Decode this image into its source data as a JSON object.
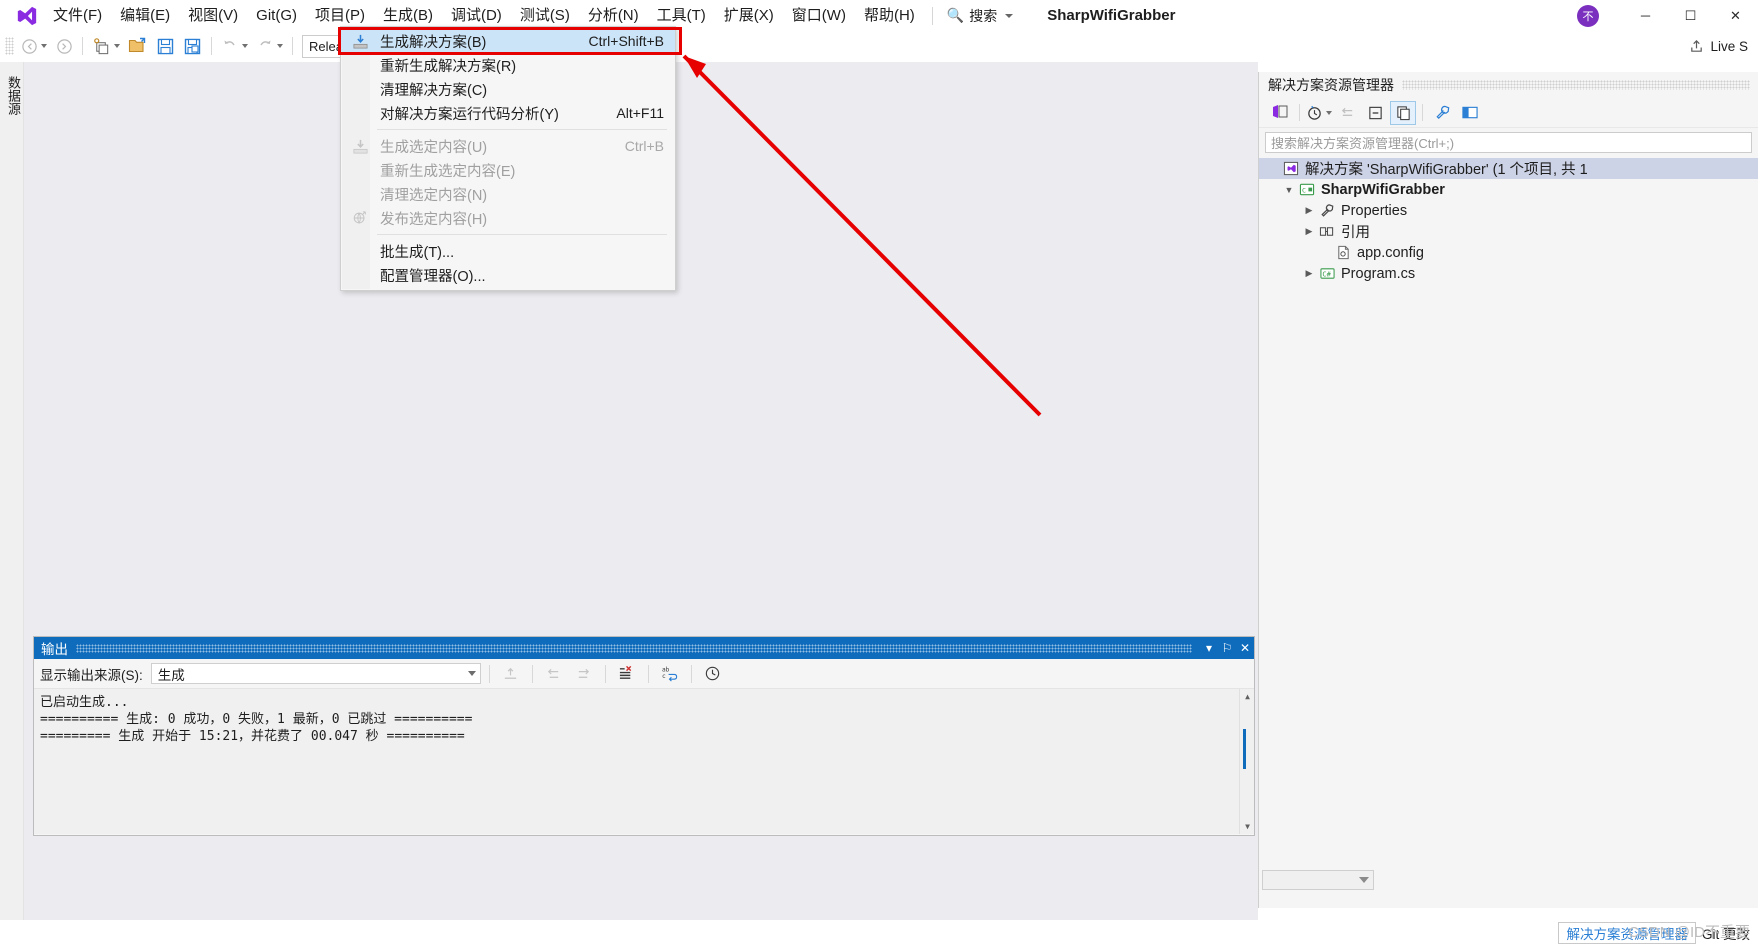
{
  "window": {
    "project_title": "SharpWifiGrabber",
    "account_initial": "不",
    "minimize": "─",
    "maximize": "☐",
    "close": "✕"
  },
  "menubar": {
    "items": [
      {
        "label": "文件(F)"
      },
      {
        "label": "编辑(E)"
      },
      {
        "label": "视图(V)"
      },
      {
        "label": "Git(G)"
      },
      {
        "label": "项目(P)"
      },
      {
        "label": "生成(B)"
      },
      {
        "label": "调试(D)"
      },
      {
        "label": "测试(S)"
      },
      {
        "label": "分析(N)"
      },
      {
        "label": "工具(T)"
      },
      {
        "label": "扩展(X)"
      },
      {
        "label": "窗口(W)"
      },
      {
        "label": "帮助(H)"
      }
    ],
    "search_label": "搜索"
  },
  "toolbar": {
    "configuration": "Release",
    "live_share": "Live S"
  },
  "left_rail": {
    "tab_label": "数据源"
  },
  "build_menu": {
    "items": [
      {
        "label": "生成解决方案(B)",
        "shortcut": "Ctrl+Shift+B",
        "enabled": true,
        "selected": true,
        "icon": "build-solution-icon",
        "separator_after": false
      },
      {
        "label": "重新生成解决方案(R)",
        "shortcut": "",
        "enabled": true,
        "selected": false,
        "icon": "",
        "separator_after": false
      },
      {
        "label": "清理解决方案(C)",
        "shortcut": "",
        "enabled": true,
        "selected": false,
        "icon": "",
        "separator_after": false
      },
      {
        "label": "对解决方案运行代码分析(Y)",
        "shortcut": "Alt+F11",
        "enabled": true,
        "selected": false,
        "icon": "",
        "separator_after": true
      },
      {
        "label": "生成选定内容(U)",
        "shortcut": "Ctrl+B",
        "enabled": false,
        "selected": false,
        "icon": "build-selection-icon",
        "separator_after": false
      },
      {
        "label": "重新生成选定内容(E)",
        "shortcut": "",
        "enabled": false,
        "selected": false,
        "icon": "",
        "separator_after": false
      },
      {
        "label": "清理选定内容(N)",
        "shortcut": "",
        "enabled": false,
        "selected": false,
        "icon": "",
        "separator_after": false
      },
      {
        "label": "发布选定内容(H)",
        "shortcut": "",
        "enabled": false,
        "selected": false,
        "icon": "publish-icon",
        "separator_after": true
      },
      {
        "label": "批生成(T)...",
        "shortcut": "",
        "enabled": true,
        "selected": false,
        "icon": "",
        "separator_after": false
      },
      {
        "label": "配置管理器(O)...",
        "shortcut": "",
        "enabled": true,
        "selected": false,
        "icon": "",
        "separator_after": false
      }
    ]
  },
  "solution_explorer": {
    "title": "解决方案资源管理器",
    "search_placeholder": "搜索解决方案资源管理器(Ctrl+;)",
    "tree": [
      {
        "label": "解决方案 'SharpWifiGrabber' (1 个项目, 共 1",
        "indent": 0,
        "twisty": "",
        "icon": "solution-icon",
        "bold": false,
        "selected": true
      },
      {
        "label": "SharpWifiGrabber",
        "indent": 1,
        "twisty": "expanded",
        "icon": "csharp-project-icon",
        "bold": true,
        "selected": false
      },
      {
        "label": "Properties",
        "indent": 2,
        "twisty": "collapsed",
        "icon": "wrench-icon",
        "bold": false,
        "selected": false
      },
      {
        "label": "引用",
        "indent": 2,
        "twisty": "collapsed",
        "icon": "references-icon",
        "bold": false,
        "selected": false
      },
      {
        "label": "app.config",
        "indent": 3,
        "twisty": "",
        "icon": "config-file-icon",
        "bold": false,
        "selected": false
      },
      {
        "label": "Program.cs",
        "indent": 2,
        "twisty": "collapsed",
        "icon": "csharp-file-icon",
        "bold": false,
        "selected": false
      }
    ]
  },
  "output_panel": {
    "title": "输出",
    "source_label": "显示输出来源(S):",
    "source_value": "生成",
    "lines": [
      "已启动生成...",
      "========== 生成: 0 成功，0 失败，1 最新，0 已跳过 ==========",
      "========= 生成 开始于 15:21，并花费了 00.047 秒 =========="
    ],
    "buttons": {
      "dropdown_caret": "▾",
      "pin": "⚐",
      "close": "✕",
      "minimize": "▾"
    }
  },
  "statusbar": {
    "solution_explorer_tab": "解决方案资源管理器",
    "git_changes": "Git 更改",
    "watermark": "CSDN @ID不重要"
  },
  "colors": {
    "accent_blue": "#0f6cbd",
    "menu_selected": "#cce4f7",
    "highlight_red": "#e60000",
    "tree_selected": "#cdd3e6",
    "workspace_bg": "#ececf0"
  }
}
